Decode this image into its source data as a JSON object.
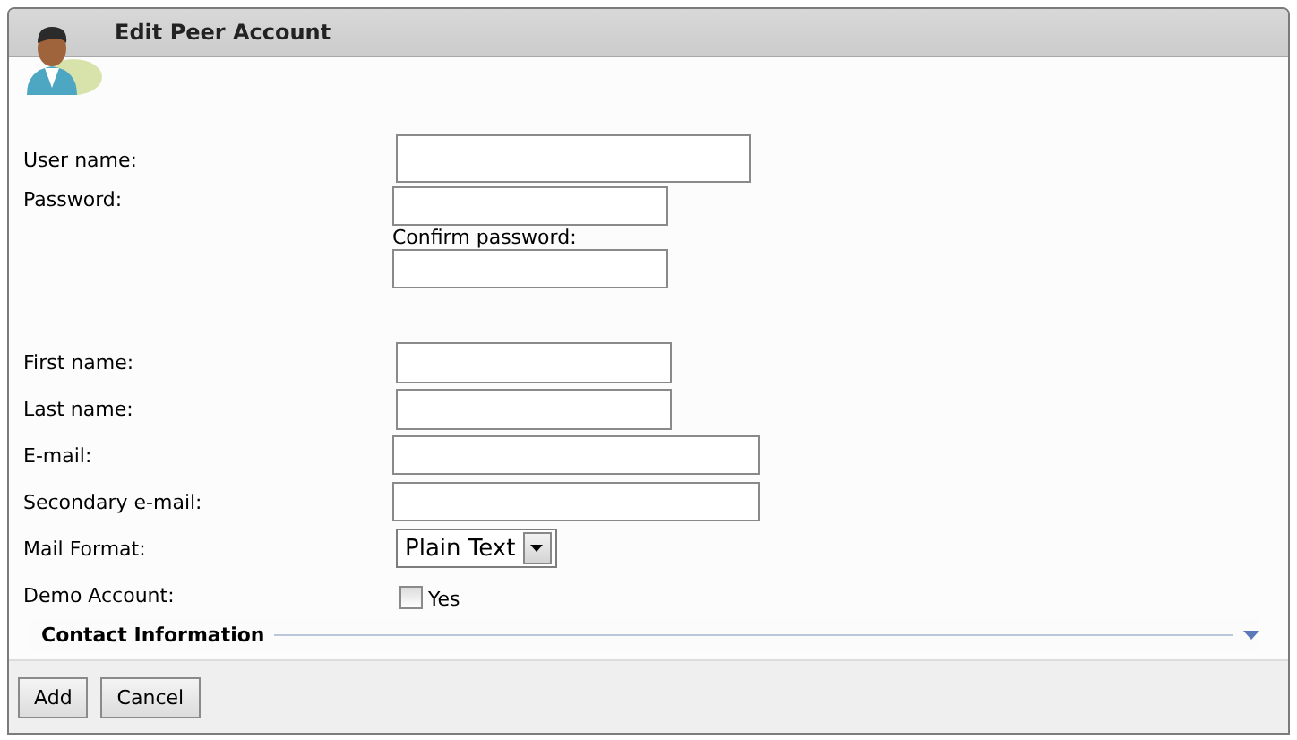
{
  "title": "Edit Peer Account",
  "fields": [
    {
      "kind": "text",
      "label": "User name:"
    },
    {
      "kind": "password",
      "label": "Password:",
      "confirm_label": "Confirm password:"
    },
    {
      "kind": "text",
      "label": "First name:"
    },
    {
      "kind": "text",
      "label": "Last name:"
    },
    {
      "kind": "text",
      "label": "E-mail:"
    },
    {
      "kind": "text",
      "label": "Secondary e-mail:"
    },
    {
      "kind": "select",
      "label": "Mail Format:",
      "value": "Plain Text"
    },
    {
      "kind": "checkbox",
      "label": "Demo Account:",
      "option": "Yes",
      "checked": false
    }
  ],
  "section": {
    "title": "Contact Information",
    "expanded": false
  },
  "buttons": [
    "Add",
    "Cancel"
  ]
}
